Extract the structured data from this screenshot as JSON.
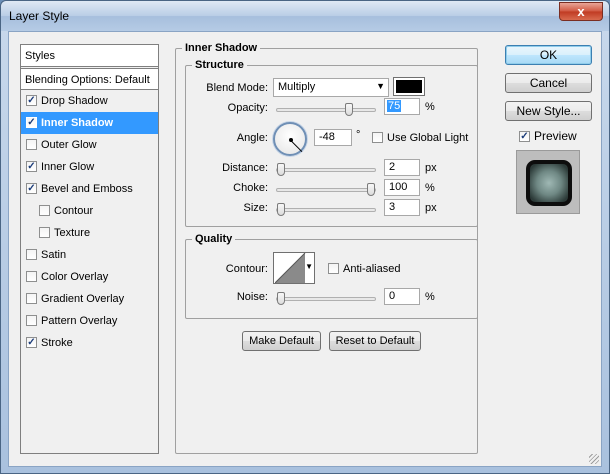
{
  "window": {
    "title": "Layer Style",
    "close_glyph": "x"
  },
  "styles_list": {
    "header": "Styles",
    "blending_options": "Blending Options: Default",
    "items": [
      {
        "label": "Drop Shadow",
        "checked": true,
        "selected": false,
        "indent": false
      },
      {
        "label": "Inner Shadow",
        "checked": true,
        "selected": true,
        "indent": false
      },
      {
        "label": "Outer Glow",
        "checked": false,
        "selected": false,
        "indent": false
      },
      {
        "label": "Inner Glow",
        "checked": true,
        "selected": false,
        "indent": false
      },
      {
        "label": "Bevel and Emboss",
        "checked": true,
        "selected": false,
        "indent": false
      },
      {
        "label": "Contour",
        "checked": false,
        "selected": false,
        "indent": true
      },
      {
        "label": "Texture",
        "checked": false,
        "selected": false,
        "indent": true
      },
      {
        "label": "Satin",
        "checked": false,
        "selected": false,
        "indent": false
      },
      {
        "label": "Color Overlay",
        "checked": false,
        "selected": false,
        "indent": false
      },
      {
        "label": "Gradient Overlay",
        "checked": false,
        "selected": false,
        "indent": false
      },
      {
        "label": "Pattern Overlay",
        "checked": false,
        "selected": false,
        "indent": false
      },
      {
        "label": "Stroke",
        "checked": true,
        "selected": false,
        "indent": false
      }
    ]
  },
  "inner_shadow": {
    "title": "Inner Shadow",
    "structure": {
      "title": "Structure",
      "blend_mode_label": "Blend Mode:",
      "blend_mode_value": "Multiply",
      "color": "#000000",
      "opacity_label": "Opacity:",
      "opacity_value": "75",
      "opacity_fraction": 0.75,
      "opacity_unit": "%",
      "angle_label": "Angle:",
      "angle_value": "-48",
      "angle_unit": "°",
      "use_global_light_label": "Use Global Light",
      "use_global_light_checked": false,
      "distance_label": "Distance:",
      "distance_value": "2",
      "distance_fraction": 0.0,
      "distance_unit": "px",
      "choke_label": "Choke:",
      "choke_value": "100",
      "choke_fraction": 1.0,
      "choke_unit": "%",
      "size_label": "Size:",
      "size_value": "3",
      "size_fraction": 0.0,
      "size_unit": "px"
    },
    "quality": {
      "title": "Quality",
      "contour_label": "Contour:",
      "anti_aliased_label": "Anti-aliased",
      "anti_aliased_checked": false,
      "noise_label": "Noise:",
      "noise_value": "0",
      "noise_fraction": 0.0,
      "noise_unit": "%"
    },
    "make_default_label": "Make Default",
    "reset_to_default_label": "Reset to Default"
  },
  "right_panel": {
    "ok_label": "OK",
    "cancel_label": "Cancel",
    "new_style_label": "New Style...",
    "preview_label": "Preview",
    "preview_checked": true
  }
}
